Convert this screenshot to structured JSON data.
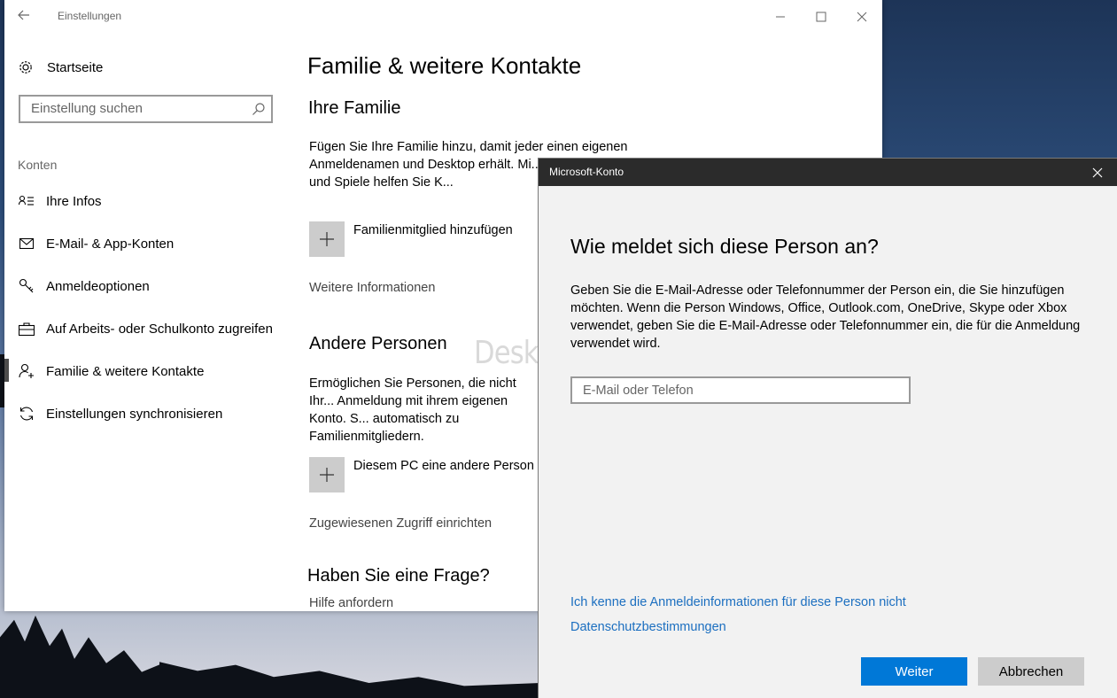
{
  "window": {
    "title": "Einstellungen"
  },
  "sidebar": {
    "home_label": "Startseite",
    "search_placeholder": "Einstellung suchen",
    "section_label": "Konten",
    "items": [
      {
        "label": "Ihre Infos",
        "icon": "person-info-icon"
      },
      {
        "label": "E-Mail- & App-Konten",
        "icon": "mail-icon"
      },
      {
        "label": "Anmeldeoptionen",
        "icon": "key-icon"
      },
      {
        "label": "Auf Arbeits- oder Schulkonto zugreifen",
        "icon": "briefcase-icon"
      },
      {
        "label": "Familie & weitere Kontakte",
        "icon": "person-add-icon",
        "selected": true
      },
      {
        "label": "Einstellungen synchronisieren",
        "icon": "sync-icon"
      }
    ]
  },
  "main": {
    "title": "Familie & weitere Kontakte",
    "family": {
      "heading": "Ihre Familie",
      "description": "Fügen Sie Ihre Familie hinzu, damit jeder einen eigenen Anmeldenamen und Desktop erhält. Mi... Zeitlimits, Apps und Spiele helfen Sie K...",
      "add_label": "Familienmitglied hinzufügen",
      "more_info": "Weitere Informationen"
    },
    "others": {
      "heading": "Andere Personen",
      "description": "Ermöglichen Sie Personen, die nicht Ihr... Anmeldung mit ihrem eigenen Konto. S... automatisch zu Familienmitgliedern.",
      "add_label": "Diesem PC eine andere Person h...",
      "assigned_access": "Zugewiesenen Zugriff einrichten"
    },
    "question": {
      "heading": "Haben Sie eine Frage?",
      "help": "Hilfe anfordern"
    },
    "watermark": "Deskmodder.de"
  },
  "dialog": {
    "title": "Microsoft-Konto",
    "heading": "Wie meldet sich diese Person an?",
    "description": "Geben Sie die E-Mail-Adresse oder Telefonnummer der Person ein, die Sie hinzufügen möchten. Wenn die Person Windows, Office, Outlook.com, OneDrive, Skype oder Xbox verwendet, geben Sie die E-Mail-Adresse oder Telefonnummer ein, die für die Anmeldung verwendet wird.",
    "input_placeholder": "E-Mail oder Telefon",
    "input_value": "",
    "link_no_info": "Ich kenne die Anmeldeinformationen für diese Person nicht",
    "link_privacy": "Datenschutzbestimmungen",
    "next_button": "Weiter",
    "cancel_button": "Abbrechen"
  },
  "colors": {
    "accent": "#0078d7",
    "link": "#1c6fc0",
    "dialog_titlebar": "#2b2b2b",
    "dialog_bg": "#f2f2f2"
  }
}
